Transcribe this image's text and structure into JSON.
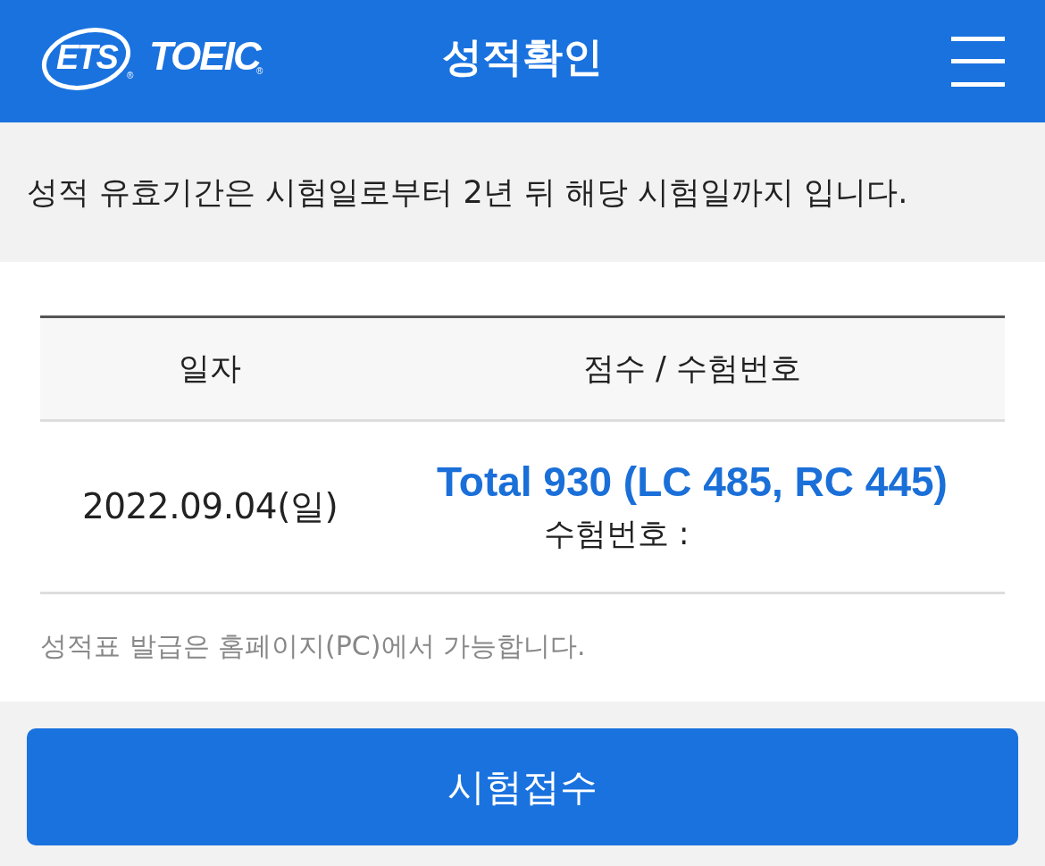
{
  "header": {
    "logo": {
      "brand": "ETS",
      "brand_mark": "®",
      "product": "TOEIC",
      "product_mark": "®"
    },
    "title": "성적확인"
  },
  "notice": "성적 유효기간은 시험일로부터 2년 뒤 해당 시험일까지 입니다.",
  "table": {
    "columns": [
      "일자",
      "점수 / 수험번호"
    ],
    "rows": [
      {
        "date": "2022.09.04(일)",
        "score": "Total 930 (LC 485, RC 445)",
        "exam_number_label": "수험번호 :"
      }
    ]
  },
  "note": "성적표 발급은 홈페이지(PC)에서 가능합니다.",
  "button": {
    "label": "시험접수"
  }
}
